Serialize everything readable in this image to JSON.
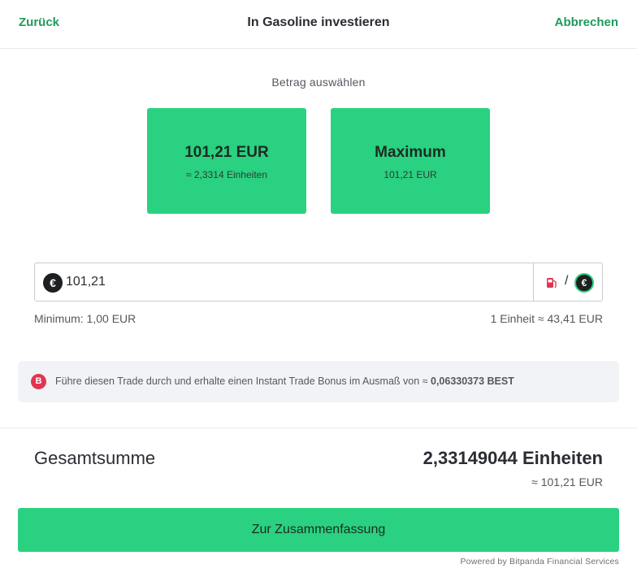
{
  "header": {
    "back_label": "Zurück",
    "title": "In Gasoline investieren",
    "cancel_label": "Abbrechen"
  },
  "amount_selection": {
    "label": "Betrag auswählen",
    "options": [
      {
        "main": "101,21 EUR",
        "sub": "≈ 2,3314 Einheiten"
      },
      {
        "main": "Maximum",
        "sub": "101,21 EUR"
      }
    ]
  },
  "amount_input": {
    "currency_symbol": "€",
    "value": "101,21",
    "switch_separator": "/",
    "switch_currency_symbol": "€",
    "fuel_icon": "fuel-pump-icon"
  },
  "limits": {
    "minimum": "Minimum: 1,00 EUR",
    "rate": "1 Einheit ≈ 43,41 EUR"
  },
  "bonus": {
    "icon_symbol": "B",
    "text": "Führe diesen Trade durch und erhalte einen Instant Trade Bonus im Ausmaß von ≈ ",
    "amount": "0,06330373 BEST"
  },
  "total": {
    "label": "Gesamtsumme",
    "value": "2,33149044 Einheiten",
    "eur": "≈ 101,21 EUR"
  },
  "summary_button_label": "Zur Zusammenfassung",
  "powered_by": "Powered by Bitpanda Financial Services",
  "colors": {
    "accent_green": "#2ad180",
    "link_green": "#1f9a5b",
    "best_red": "#e0364f"
  }
}
